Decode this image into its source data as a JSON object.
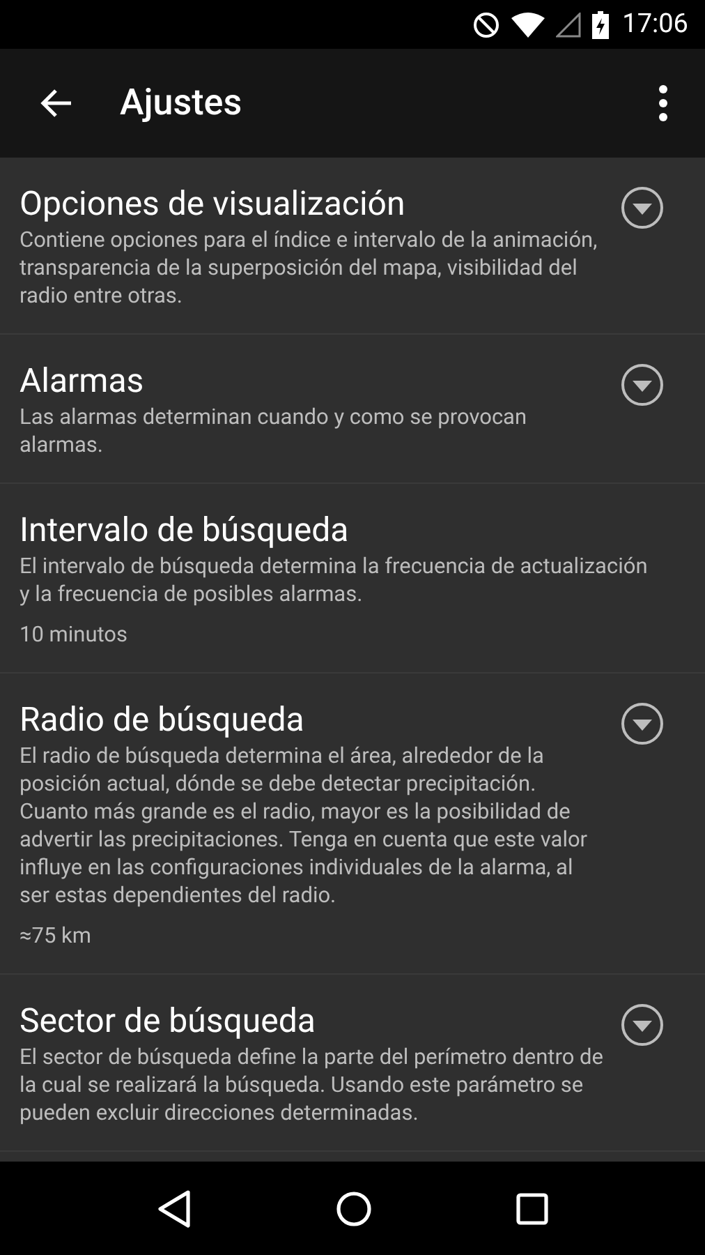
{
  "status_bar": {
    "time": "17:06"
  },
  "toolbar": {
    "title": "Ajustes"
  },
  "settings": [
    {
      "kind": "expandable",
      "title": "Opciones de visualización",
      "summary": "Contiene opciones para el índice e intervalo de la animación, transparencia de la superposición del mapa, visibilidad del radio entre otras."
    },
    {
      "kind": "expandable",
      "title": "Alarmas",
      "summary": "Las alarmas determinan cuando y como se provocan alarmas."
    },
    {
      "kind": "plain",
      "title": "Intervalo de búsqueda",
      "summary": "El intervalo de búsqueda determina la frecuencia de actualización y la frecuencia de posibles alarmas.",
      "value": "10 minutos"
    },
    {
      "kind": "expandable",
      "title": "Radio de búsqueda",
      "summary": "El radio de búsqueda determina el área, alrededor de la posición actual, dónde se debe detectar precipitación. Cuanto más grande es el radio, mayor es la posibilidad de advertir las precipitaciones. Tenga en cuenta que este valor influye en las configuraciones individuales de la alarma, al ser estas dependientes del radio.",
      "value": "≈75 km"
    },
    {
      "kind": "expandable",
      "title": "Sector de búsqueda",
      "summary": "El sector de búsqueda define la parte del perímetro dentro de la cual se realizará la búsqueda. Usando este parámetro se pueden excluir direcciones determinadas."
    }
  ]
}
